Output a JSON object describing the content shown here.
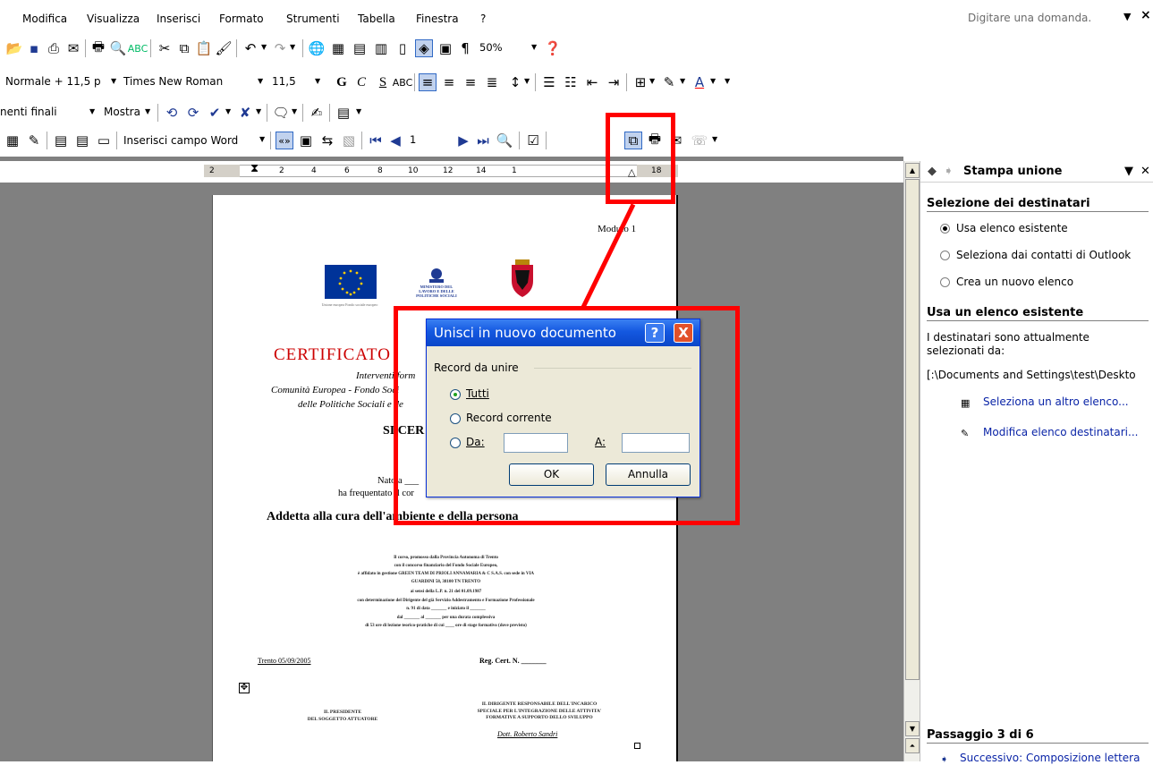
{
  "menu": {
    "items": [
      "Modifica",
      "Visualizza",
      "Inserisci",
      "Formato",
      "Strumenti",
      "Tabella",
      "Finestra",
      "?"
    ],
    "ask_placeholder": "Digitare una domanda."
  },
  "toolbar_standard": {
    "zoom": "50%"
  },
  "toolbar_format": {
    "style": "Normale + 11,5 p",
    "font": "Times New Roman",
    "size": "11,5",
    "bold_label": "G",
    "italic_label": "C",
    "underline_label": "S"
  },
  "toolbar_review": {
    "markup_label": "nenti finali",
    "show_label": "Mostra"
  },
  "toolbar_mailmerge": {
    "insert_field_label": "Inserisci campo Word",
    "record_number": "1"
  },
  "ruler": {
    "labels": [
      "2",
      "2",
      "4",
      "6",
      "8",
      "10",
      "12",
      "14",
      "1",
      "18"
    ]
  },
  "document": {
    "modulo": "Modulo 1",
    "eu_caption": "Unione europea Fondo sociale europeo",
    "ministry_label": "MINISTERO DEL LAVORO E DELLE POLITICHE SOCIALI",
    "title_partial": "CERTIFICATO",
    "line1": "Interventi form",
    "line2": "Comunità Europea - Fondo Soci",
    "line3": "delle Politiche Sociali e de",
    "si_cert": "SI CER",
    "nato": "Nato a ___",
    "frequentato": "ha frequentato il cor",
    "course": "Addetta alla cura dell'ambiente e della persona",
    "small_lines": [
      "Il corso, promosso dalla Provincia Autonoma di Trento",
      "con il concorso finanziario del Fondo Sociale Europeo,",
      "è affidato in gestione GREEN TEAM DI PRIOLI ANNAMARIA & C S.A.S. con sede in VIA",
      "GUARDINI 58, 38100 TN TRENTO",
      "ai sensi della L.P. n. 21 del 01.09.1987",
      "con determinazione del Dirigente del già Servizio Addestramento e Formazione Professionale",
      "n. 91 di data _______ e iniziato il _______",
      "dal _______ al _______ per una durata complessiva",
      "di 53 ore di lezione teorico-pratiche di cui ____ ore di stage formativo (dove previsto)"
    ],
    "place_date": "Trento 05/09/2005",
    "register": "Reg. Cert. N. _______",
    "sig_left": [
      "IL PRESIDENTE",
      "DEL SOGGETTO ATTUATORE"
    ],
    "sig_right": [
      "IL DIRIGENTE RESPONSABILE DELL'INCARICO",
      "SPECIALE PER L'INTEGRAZIONE DELLE ATTIVITA'",
      "FORMATIVE A SUPPORTO DELLO SVILUPPO"
    ],
    "signature": "Dott. Roberto Sandri"
  },
  "dialog": {
    "title": "Unisci in nuovo documento",
    "help": "?",
    "close": "X",
    "group_label": "Record da unire",
    "option_all": "Tutti",
    "option_current": "Record corrente",
    "option_from": "Da:",
    "to_label": "A:",
    "ok": "OK",
    "cancel": "Annulla"
  },
  "taskpane": {
    "title": "Stampa unione",
    "section1": "Selezione dei destinatari",
    "options": [
      "Usa elenco esistente",
      "Seleziona dai contatti di Outlook",
      "Crea un nuovo elenco"
    ],
    "section2": "Usa un elenco esistente",
    "desc1": "I destinatari sono attualmente",
    "desc2": "selezionati da:",
    "path": "[:\\Documents and Settings\\test\\Deskto",
    "link1": "Seleziona un altro elenco...",
    "link2": "Modifica elenco destinatari...",
    "step": "Passaggio 3 di 6",
    "next": "Successivo: Composizione lettera"
  },
  "colors": {
    "annotation": "#ff0000",
    "dialog_title": "#1458e0",
    "link": "#0a24a7",
    "title_red": "#cc0000"
  }
}
